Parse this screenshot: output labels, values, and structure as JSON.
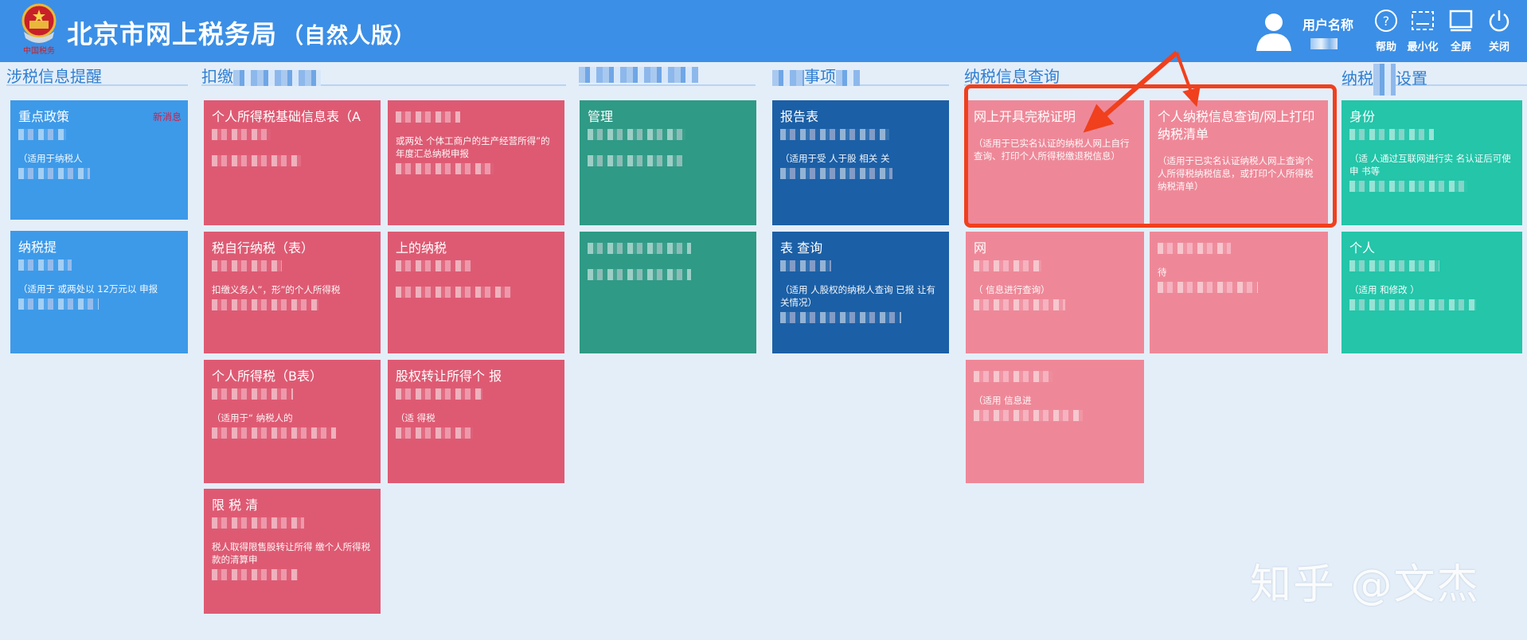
{
  "header": {
    "title": "北京市网上税务局",
    "subtitle": "（自然人版）",
    "logo_text": "中国税务",
    "user_label": "用户名称",
    "tools": [
      {
        "icon": "help-icon",
        "label": "帮助"
      },
      {
        "icon": "minimize-icon",
        "label": "最小化"
      },
      {
        "icon": "fullscreen-icon",
        "label": "全屏"
      },
      {
        "icon": "power-icon",
        "label": "关闭"
      }
    ]
  },
  "nav": [
    {
      "label": "涉税信息提醒",
      "tail": ""
    },
    {
      "label": "扣缴",
      "tail": ""
    },
    {
      "label": "",
      "tail": ""
    },
    {
      "label": "",
      "tail": "事项"
    },
    {
      "label": "纳税信息查询",
      "tail": ""
    },
    {
      "label": "纳税",
      "tail": "设置"
    }
  ],
  "cards": [
    {
      "title": "重点政策",
      "badge": "新消息",
      "desc": "（适用于纳税人"
    },
    {
      "title": "纳税提",
      "desc": "（适用于 或两处以 12万元以 申报"
    },
    {
      "title": "个人所得税基础信息表（A",
      "desc": ""
    },
    {
      "title": "",
      "desc": "或两处 个体工商户的生产经营所得”的年度汇总纳税申报"
    },
    {
      "title": "税自行纳税（表）",
      "desc": "扣缴义务人”，形”的个人所得税"
    },
    {
      "title": "上的纳税",
      "desc": ""
    },
    {
      "title": "个人所得税（B表）",
      "desc": "（适用于“ 纳税人的"
    },
    {
      "title": "股权转让所得个 报",
      "desc": "（适 得税"
    },
    {
      "title": "限 税 清",
      "desc": "税人取得限售股转让所得 缴个人所得税款的清算申"
    },
    {
      "title": "管理",
      "desc": ""
    },
    {
      "title": "",
      "desc": ""
    },
    {
      "title": "报告表",
      "desc": "（适用于受 人于股 相关 关"
    },
    {
      "title": "表 查询",
      "desc": "（适用 人股权的纳税人查询 已报 让有关情况）"
    },
    {
      "title": "网上开具完税证明",
      "desc": "（适用于已实名认证的纳税人网上自行查询、打印个人所得税缴退税信息）"
    },
    {
      "title": "个人纳税信息查询/网上打印纳税清单",
      "desc": "（适用于已实名认证纳税人网上查询个人所得税纳税信息，或打印个人所得税纳税清单）"
    },
    {
      "title": "网",
      "desc": "（ 信息进行查询）"
    },
    {
      "title": "",
      "desc": "待"
    },
    {
      "title": "",
      "desc": "（适用 信息进"
    },
    {
      "title": "身份",
      "desc": "（适 人通过互联网进行实 名认证后可使 申 书等"
    },
    {
      "title": "个人",
      "desc": "（适用 和修改 ）"
    }
  ],
  "watermark": "知乎 @文杰",
  "colors": {
    "header": "#3b8fe6",
    "highlight": "#f0401d",
    "card_pink": "#ee8898"
  }
}
